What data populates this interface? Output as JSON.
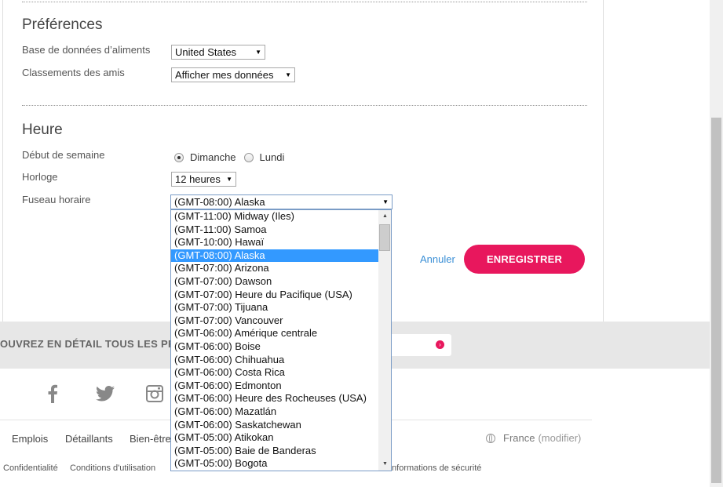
{
  "preferences": {
    "title": "Préférences",
    "food_db_label": "Base de données d’aliments",
    "food_db_value": "United States",
    "friends_label": "Classements des amis",
    "friends_value": "Afficher mes données"
  },
  "time": {
    "title": "Heure",
    "week_start_label": "Début de semaine",
    "week_options": [
      "Dimanche",
      "Lundi"
    ],
    "week_selected": "Dimanche",
    "clock_label": "Horloge",
    "clock_value": "12 heures",
    "timezone_label": "Fuseau horaire",
    "timezone_value": "(GMT-08:00) Alaska"
  },
  "actions": {
    "cancel": "Annuler",
    "save": "ENREGISTRER"
  },
  "timezone_options": [
    "(GMT-11:00) Midway (Iles)",
    "(GMT-11:00) Samoa",
    "(GMT-10:00) Hawaï",
    "(GMT-08:00) Alaska",
    "(GMT-07:00) Arizona",
    "(GMT-07:00) Dawson",
    "(GMT-07:00) Heure du Pacifique (USA)",
    "(GMT-07:00) Tijuana",
    "(GMT-07:00) Vancouver",
    "(GMT-06:00) Amérique centrale",
    "(GMT-06:00) Boise",
    "(GMT-06:00) Chihuahua",
    "(GMT-06:00) Costa Rica",
    "(GMT-06:00) Edmonton",
    "(GMT-06:00) Heure des Rocheuses (USA)",
    "(GMT-06:00) Mazatlán",
    "(GMT-06:00) Saskatchewan",
    "(GMT-05:00) Atikokan",
    "(GMT-05:00) Baie de Banderas",
    "(GMT-05:00) Bogota"
  ],
  "timezone_selected_index": 3,
  "promo": {
    "text": "OUVREZ EN DÉTAIL TOUS LES PR"
  },
  "social_icons": [
    "facebook-icon",
    "twitter-icon",
    "instagram-icon"
  ],
  "footer": {
    "links": [
      "Emplois",
      "Détaillants",
      "Bien-être"
    ],
    "region": "France",
    "region_modify": "(modifier)",
    "small_links": [
      "Confidentialité",
      "Conditions d'utilisation",
      "Informations de sécurité"
    ]
  },
  "colors": {
    "accent": "#e8175d",
    "link": "#3a8fd6",
    "selection": "#3399ff"
  }
}
